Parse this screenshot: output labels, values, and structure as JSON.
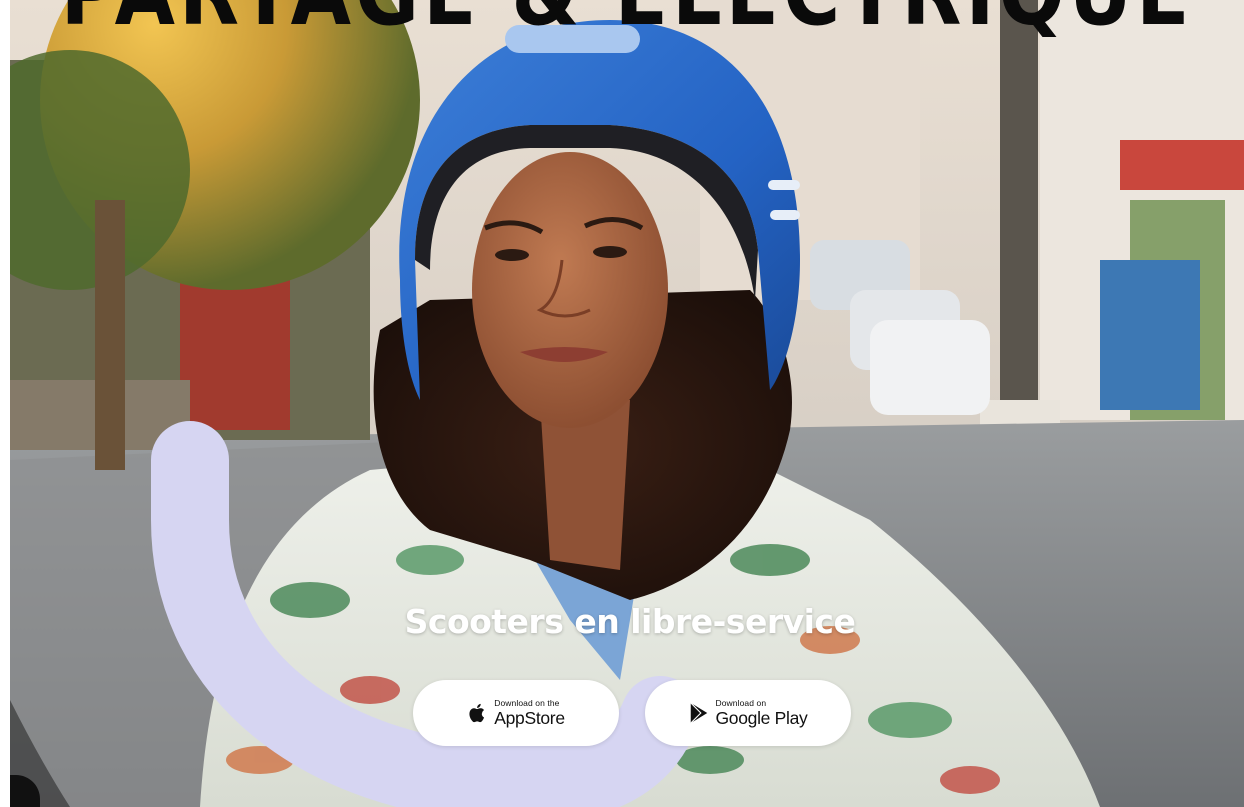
{
  "hero": {
    "headline": "PARTAGÉ & ÉLECTRIQUE",
    "tagline": "Scooters en libre-service",
    "photo_icon": "hero-photo-woman-helmet"
  },
  "downloads": {
    "appstore": {
      "small_label": "Download on the",
      "big_label": "AppStore",
      "icon": "apple-icon"
    },
    "googleplay": {
      "small_label": "Download on",
      "big_label": "Google Play",
      "icon": "play-icon"
    }
  },
  "colors": {
    "arc": "#d6d5f2",
    "headline": "#0a0a0a",
    "tagline": "#ffffff",
    "button_bg": "#ffffff"
  }
}
